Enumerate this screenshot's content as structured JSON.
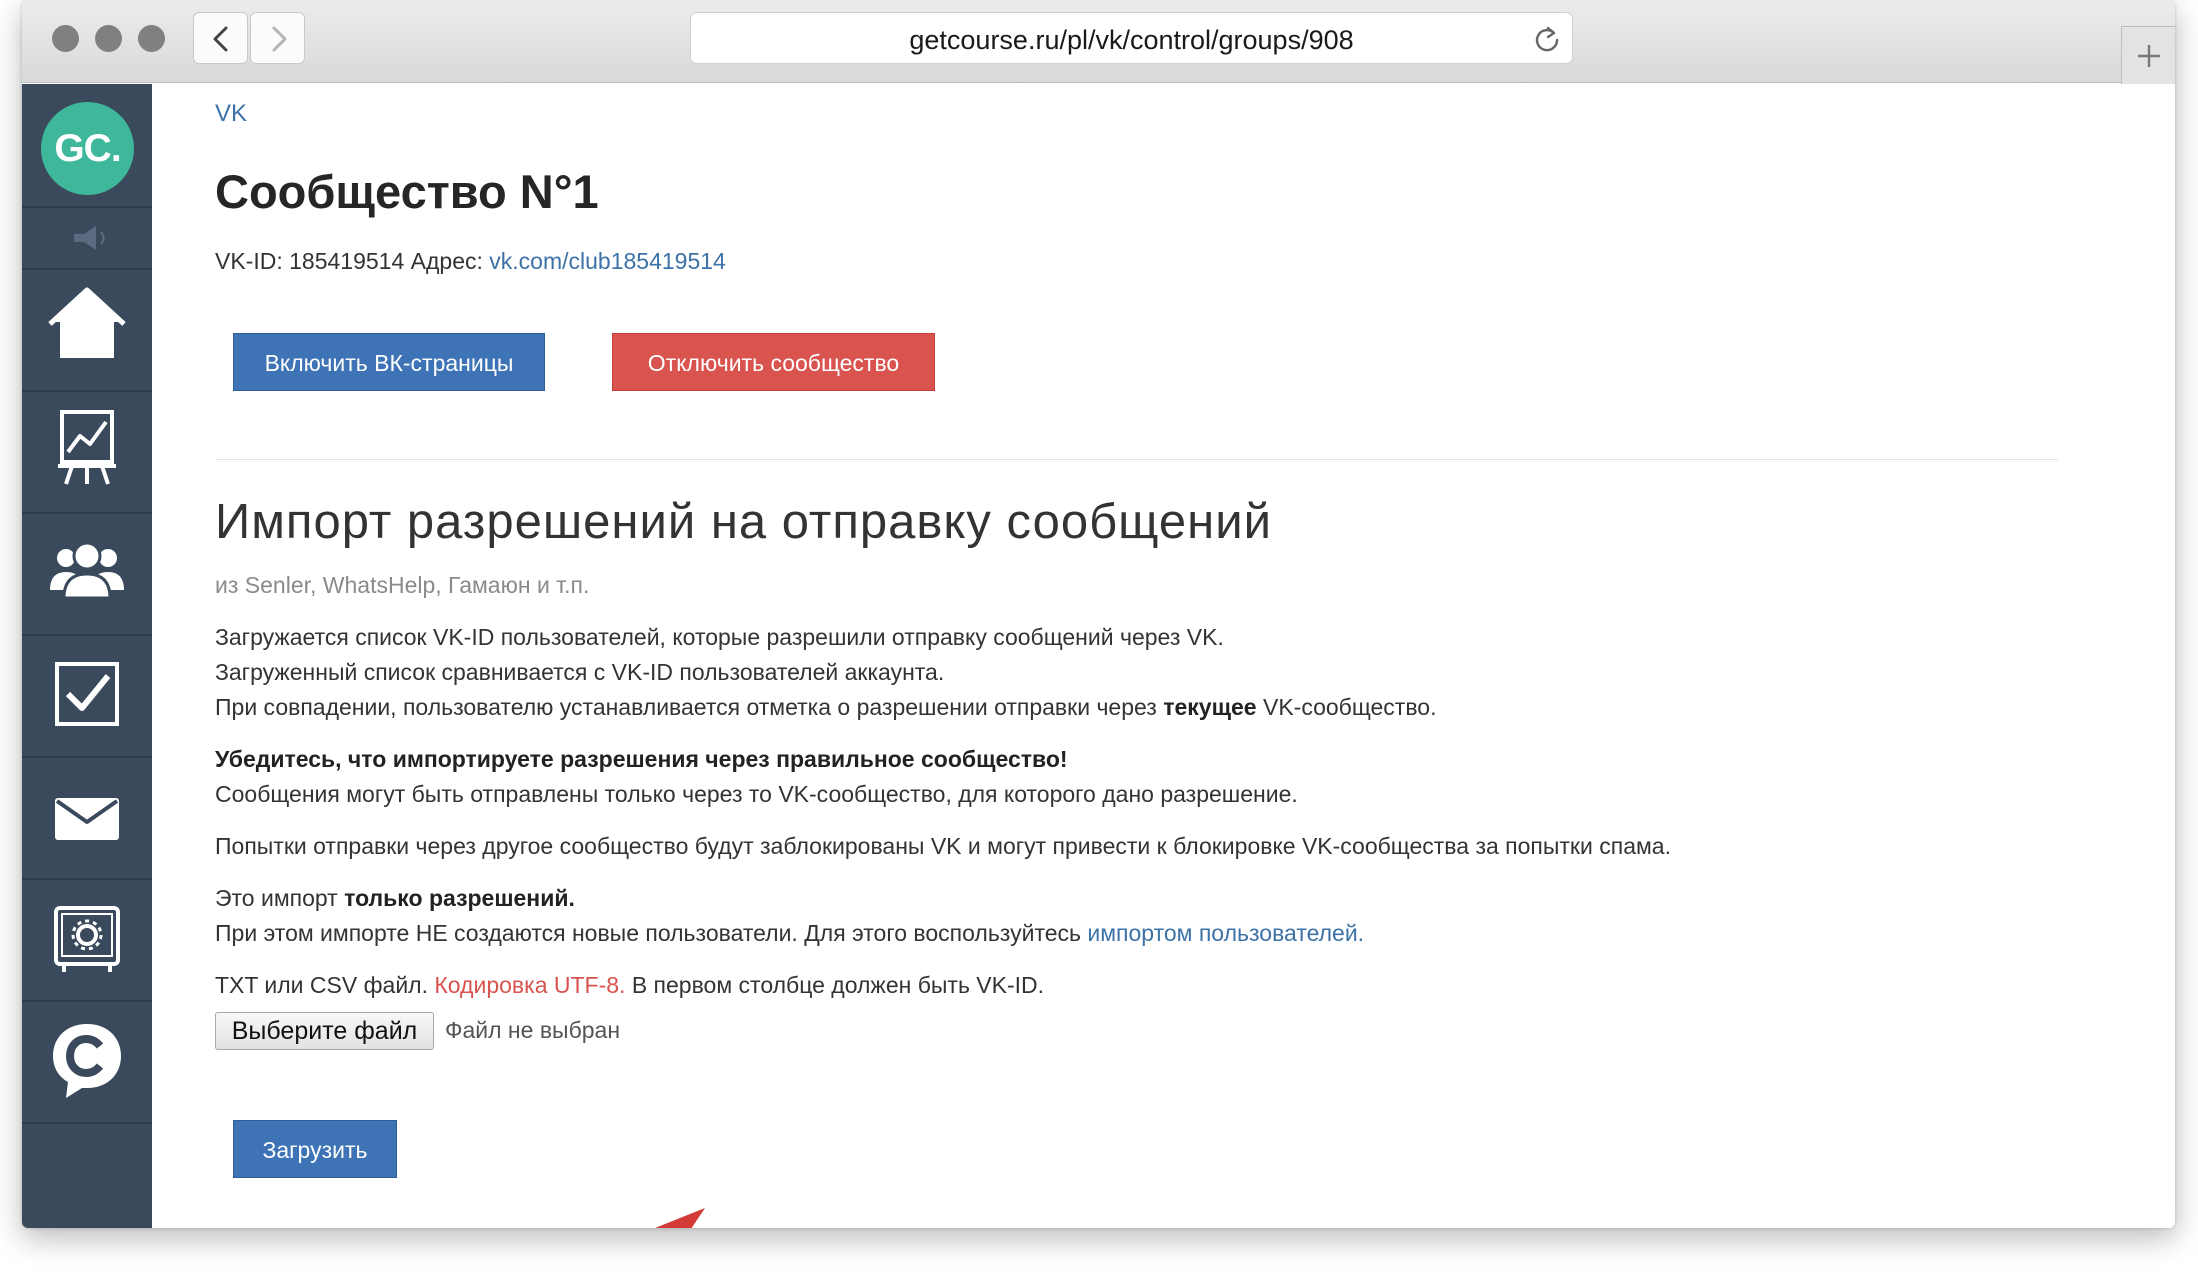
{
  "browser": {
    "url": "getcourse.ru/pl/vk/control/groups/908"
  },
  "sidebar": {
    "logo": "GC.",
    "items": [
      {
        "icon": "megaphone-icon"
      },
      {
        "icon": "home-icon"
      },
      {
        "icon": "chart-icon"
      },
      {
        "icon": "users-icon"
      },
      {
        "icon": "checkbox-icon"
      },
      {
        "icon": "mail-icon"
      },
      {
        "icon": "settings-icon"
      },
      {
        "icon": "chat-icon"
      }
    ]
  },
  "breadcrumb": "VK",
  "page": {
    "title": "Сообщество N°1",
    "vk_id_label": "VK-ID: 185419514 Адрес: ",
    "vk_link": "vk.com/club185419514",
    "enable_button": "Включить ВК-страницы",
    "disable_button": "Отключить сообщество"
  },
  "import": {
    "title": "Импорт разрешений на отправку сообщений",
    "subtitle": "из Senler, WhatsHelp, Гамаюн и т.п.",
    "line1": "Загружается список VK-ID пользователей, которые разрешили отправку сообщений через VK.",
    "line2": "Загруженный список сравнивается с VK-ID пользователей аккаунта.",
    "line3_pre": "При совпадении, пользователю устанавливается отметка о разрешении отправки через ",
    "line3_bold": "текущее",
    "line3_post": " VK-сообщество.",
    "warning_bold": "Убедитесь, что импортируете разрешения через правильное сообщество!",
    "warning_text": "Сообщения могут быть отправлены только через то VK-сообщество, для которого дано разрешение.",
    "spam_text": "Попытки отправки через другое сообщество будут заблокированы VK и могут привести к блокировке VK-сообщества за попытки спама.",
    "only_pre": "Это импорт ",
    "only_bold": "только разрешений.",
    "users_pre": "При этом импорте НЕ создаются новые пользователи. Для этого воспользуйтесь ",
    "users_link": "импортом пользователей.",
    "format_pre": "TXT или CSV файл. ",
    "format_red": "Кодировка UTF-8.",
    "format_post": " В первом столбце должен быть VK-ID.",
    "file_button": "Выберите файл",
    "file_status": "Файл не выбран",
    "upload_button": "Загрузить"
  },
  "colors": {
    "sidebar": "#3a4a5c",
    "logo": "#3fb79a",
    "primary": "#3e73b6",
    "danger": "#d9534f",
    "link": "#3c72a6",
    "arrow": "#d23b36"
  }
}
